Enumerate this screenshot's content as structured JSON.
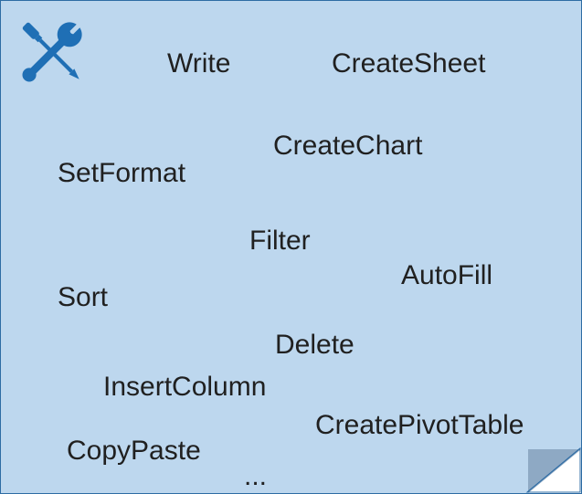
{
  "icon": "tools-icon",
  "words": {
    "write": "Write",
    "createsheet": "CreateSheet",
    "createchart": "CreateChart",
    "setformat": "SetFormat",
    "filter": "Filter",
    "autofill": "AutoFill",
    "sort": "Sort",
    "delete": "Delete",
    "insertcolumn": "InsertColumn",
    "createpivottable": "CreatePivotTable",
    "copypaste": "CopyPaste",
    "ellipsis": "..."
  }
}
